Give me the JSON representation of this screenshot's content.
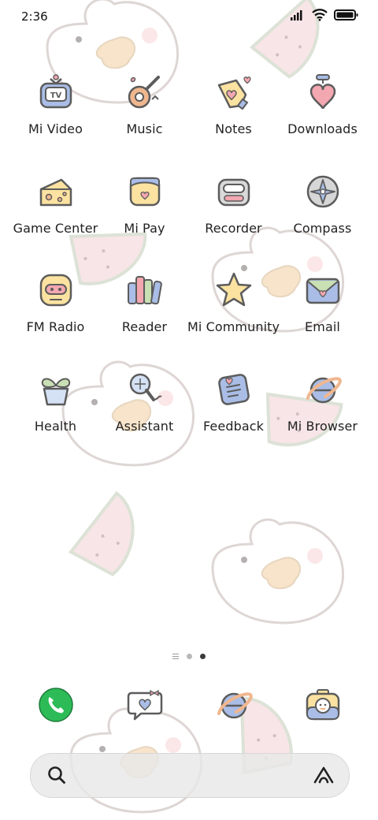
{
  "status_bar": {
    "time": "2:36",
    "icons": [
      "signal-icon",
      "wifi-icon",
      "battery-icon"
    ]
  },
  "apps": [
    {
      "label": "Mi Video",
      "icon": "tv-icon"
    },
    {
      "label": "Music",
      "icon": "guitar-icon"
    },
    {
      "label": "Notes",
      "icon": "notes-icon"
    },
    {
      "label": "Downloads",
      "icon": "download-heart-icon"
    },
    {
      "label": "Game Center",
      "icon": "cheese-icon"
    },
    {
      "label": "Mi Pay",
      "icon": "wallet-icon"
    },
    {
      "label": "Recorder",
      "icon": "recorder-icon"
    },
    {
      "label": "Compass",
      "icon": "compass-icon"
    },
    {
      "label": "FM Radio",
      "icon": "radio-icon"
    },
    {
      "label": "Reader",
      "icon": "books-icon"
    },
    {
      "label": "Mi Community",
      "icon": "star-icon"
    },
    {
      "label": "Email",
      "icon": "envelope-icon"
    },
    {
      "label": "Health",
      "icon": "plant-icon"
    },
    {
      "label": "Assistant",
      "icon": "mic-icon"
    },
    {
      "label": "Feedback",
      "icon": "feedback-icon"
    },
    {
      "label": "Mi Browser",
      "icon": "browser-icon"
    }
  ],
  "dock": [
    {
      "name": "phone",
      "icon": "phone-icon",
      "color": "#2dbb57"
    },
    {
      "name": "messaging",
      "icon": "message-heart-icon"
    },
    {
      "name": "browser",
      "icon": "browser-icon"
    },
    {
      "name": "camera",
      "icon": "camera-duck-icon"
    }
  ],
  "page_indicator": {
    "pages": 2,
    "active": 2
  },
  "search_bar": {
    "left_icon": "search-icon",
    "right_icon": "assistant-icon"
  },
  "theme": {
    "icon_stroke": "#5c5c5c",
    "pink": "#f3a7b0",
    "blue": "#a9bde6",
    "yellow": "#fbe2a0"
  }
}
